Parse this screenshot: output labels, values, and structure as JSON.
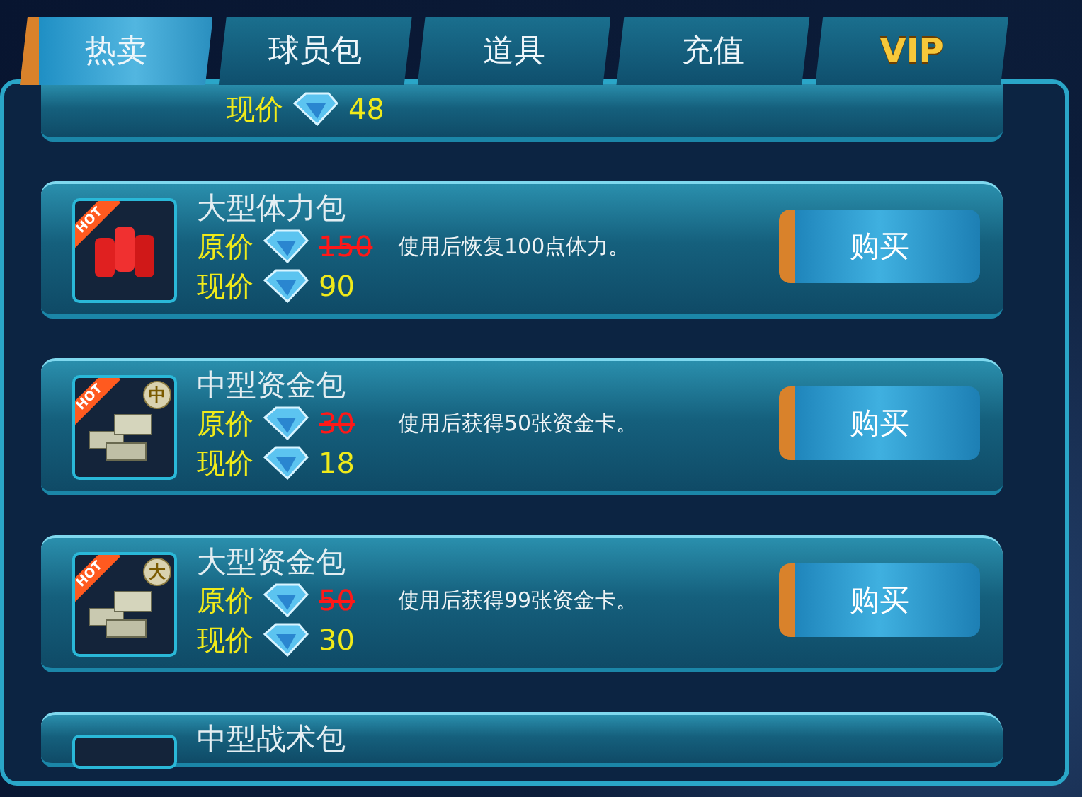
{
  "tabs": [
    {
      "label": "热卖",
      "selected": true
    },
    {
      "label": "球员包",
      "selected": false
    },
    {
      "label": "道具",
      "selected": false
    },
    {
      "label": "充值",
      "selected": false
    },
    {
      "label": "VIP",
      "selected": false,
      "kind": "vip"
    }
  ],
  "top_partial": {
    "current_label": "现价",
    "current_price": "48"
  },
  "items": [
    {
      "name": "大型体力包",
      "badge": "HOT",
      "kind": "bottles",
      "original_label": "原价",
      "original_price": "150",
      "description": "使用后恢复100点体力。",
      "current_label": "现价",
      "current_price": "90",
      "buy_label": "购买"
    },
    {
      "name": "中型资金包",
      "badge": "HOT",
      "kind": "money",
      "coin": "中",
      "original_label": "原价",
      "original_price": "30",
      "description": "使用后获得50张资金卡。",
      "current_label": "现价",
      "current_price": "18",
      "buy_label": "购买"
    },
    {
      "name": "大型资金包",
      "badge": "HOT",
      "kind": "money",
      "coin": "大",
      "original_label": "原价",
      "original_price": "50",
      "description": "使用后获得99张资金卡。",
      "current_label": "现价",
      "current_price": "30",
      "buy_label": "购买"
    }
  ],
  "bottom_partial": {
    "name": "中型战术包"
  }
}
